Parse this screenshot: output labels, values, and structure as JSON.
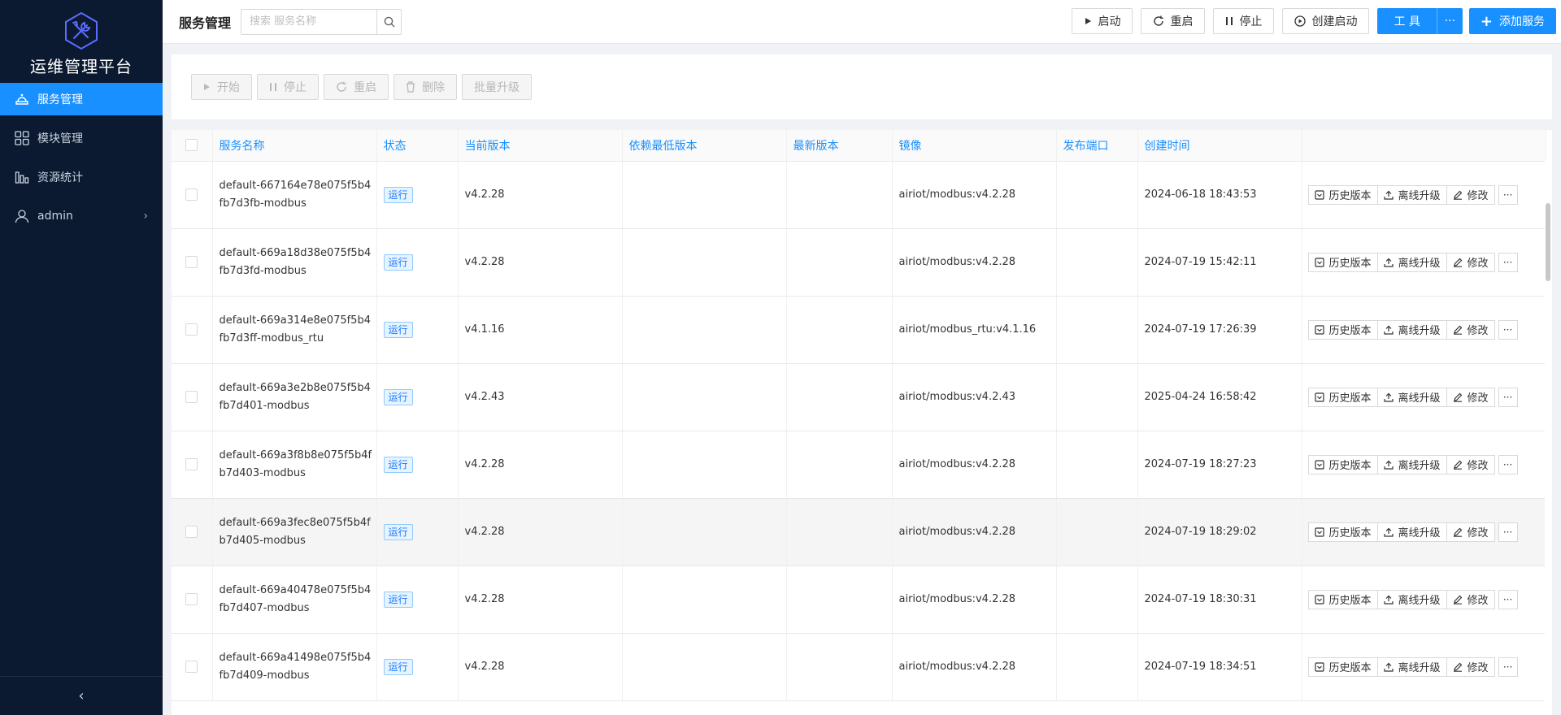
{
  "app": {
    "brand": "运维管理平台"
  },
  "sidebar": {
    "items": [
      {
        "label": "服务管理",
        "icon": "service-icon",
        "active": true
      },
      {
        "label": "模块管理",
        "icon": "module-icon",
        "active": false
      },
      {
        "label": "资源统计",
        "icon": "chart-icon",
        "active": false
      },
      {
        "label": "admin",
        "icon": "user-icon",
        "active": false
      }
    ],
    "collapse_label": "‹"
  },
  "header": {
    "title": "服务管理",
    "search_placeholder": "搜索 服务名称",
    "buttons": {
      "start": "启动",
      "restart": "重启",
      "stop": "停止",
      "create_start": "创建启动",
      "tools": "工 具",
      "tools_more": "···",
      "add_service": "添加服务"
    }
  },
  "actions": {
    "start": "开始",
    "stop": "停止",
    "restart": "重启",
    "delete": "删除",
    "batch_upgrade": "批量升级"
  },
  "table": {
    "columns": [
      "服务名称",
      "状态",
      "当前版本",
      "依赖最低版本",
      "最新版本",
      "镜像",
      "发布端口",
      "创建时间",
      ""
    ],
    "row_actions": {
      "history": "历史版本",
      "offline_upgrade": "离线升级",
      "edit": "修改",
      "more": "···"
    },
    "rows": [
      {
        "name": "default-667164e78e075f5b4fb7d3fb-modbus",
        "status": "运行",
        "version": "v4.2.28",
        "min_dep": "",
        "latest": "",
        "image": "airiot/modbus:v4.2.28",
        "port": "",
        "created": "2024-06-18 18:43:53"
      },
      {
        "name": "default-669a18d38e075f5b4fb7d3fd-modbus",
        "status": "运行",
        "version": "v4.2.28",
        "min_dep": "",
        "latest": "",
        "image": "airiot/modbus:v4.2.28",
        "port": "",
        "created": "2024-07-19 15:42:11"
      },
      {
        "name": "default-669a314e8e075f5b4fb7d3ff-modbus_rtu",
        "status": "运行",
        "version": "v4.1.16",
        "min_dep": "",
        "latest": "",
        "image": "airiot/modbus_rtu:v4.1.16",
        "port": "",
        "created": "2024-07-19 17:26:39"
      },
      {
        "name": "default-669a3e2b8e075f5b4fb7d401-modbus",
        "status": "运行",
        "version": "v4.2.43",
        "min_dep": "",
        "latest": "",
        "image": "airiot/modbus:v4.2.43",
        "port": "",
        "created": "2025-04-24 16:58:42"
      },
      {
        "name": "default-669a3f8b8e075f5b4fb7d403-modbus",
        "status": "运行",
        "version": "v4.2.28",
        "min_dep": "",
        "latest": "",
        "image": "airiot/modbus:v4.2.28",
        "port": "",
        "created": "2024-07-19 18:27:23"
      },
      {
        "name": "default-669a3fec8e075f5b4fb7d405-modbus",
        "status": "运行",
        "version": "v4.2.28",
        "min_dep": "",
        "latest": "",
        "image": "airiot/modbus:v4.2.28",
        "port": "",
        "created": "2024-07-19 18:29:02"
      },
      {
        "name": "default-669a40478e075f5b4fb7d407-modbus",
        "status": "运行",
        "version": "v4.2.28",
        "min_dep": "",
        "latest": "",
        "image": "airiot/modbus:v4.2.28",
        "port": "",
        "created": "2024-07-19 18:30:31"
      },
      {
        "name": "default-669a41498e075f5b4fb7d409-modbus",
        "status": "运行",
        "version": "v4.2.28",
        "min_dep": "",
        "latest": "",
        "image": "airiot/modbus:v4.2.28",
        "port": "",
        "created": "2024-07-19 18:34:51"
      }
    ]
  },
  "colors": {
    "sidebar_bg": "#0b1a30",
    "accent": "#1890ff",
    "status_bg": "#e6f4ff"
  }
}
